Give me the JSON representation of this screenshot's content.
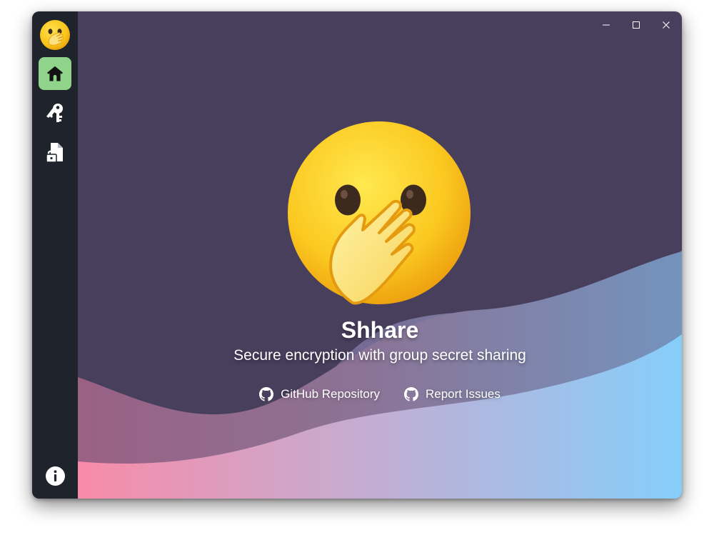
{
  "app": {
    "title": "Shhare",
    "subtitle": "Secure encryption with group secret sharing"
  },
  "sidebar": {
    "items": [
      {
        "icon": "home-icon",
        "active": true
      },
      {
        "icon": "keys-icon",
        "active": false
      },
      {
        "icon": "locked-file-icon",
        "active": false
      }
    ],
    "footer_icon": "info-icon"
  },
  "links": [
    {
      "label": "GitHub Repository",
      "icon": "github-icon"
    },
    {
      "label": "Report Issues",
      "icon": "github-icon"
    }
  ],
  "window_controls": [
    "minimize-icon",
    "maximize-icon",
    "close-icon"
  ],
  "colors": {
    "background": "#483f5d",
    "sidebar": "#1f232c",
    "active_nav": "#8fd48a",
    "wave_pink": "#f88ba8",
    "wave_blue": "#86cefa"
  }
}
